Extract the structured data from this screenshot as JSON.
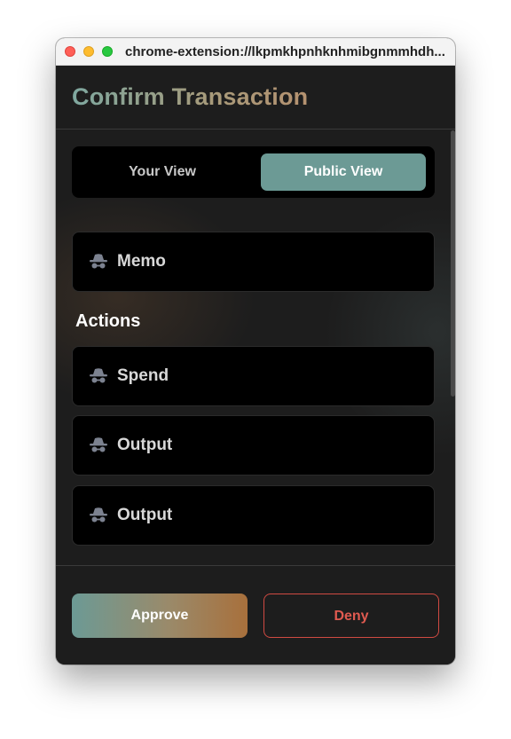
{
  "window": {
    "url": "chrome-extension://lkpmkhpnhknhmibgnmmhdh..."
  },
  "header": {
    "title": "Confirm Transaction"
  },
  "view_toggle": {
    "options": [
      "Your View",
      "Public View"
    ],
    "selected": "Public View"
  },
  "memo": {
    "label": "Memo",
    "icon": "incognito-icon"
  },
  "actions": {
    "title": "Actions",
    "items": [
      {
        "label": "Spend",
        "icon": "incognito-icon"
      },
      {
        "label": "Output",
        "icon": "incognito-icon"
      },
      {
        "label": "Output",
        "icon": "incognito-icon"
      }
    ]
  },
  "footer": {
    "approve_label": "Approve",
    "deny_label": "Deny"
  },
  "colors": {
    "accent": "#6c9a95",
    "approve_gradient_end": "#a8703c",
    "deny": "#e05a50",
    "background": "#1d1d1d",
    "card": "#000000"
  }
}
